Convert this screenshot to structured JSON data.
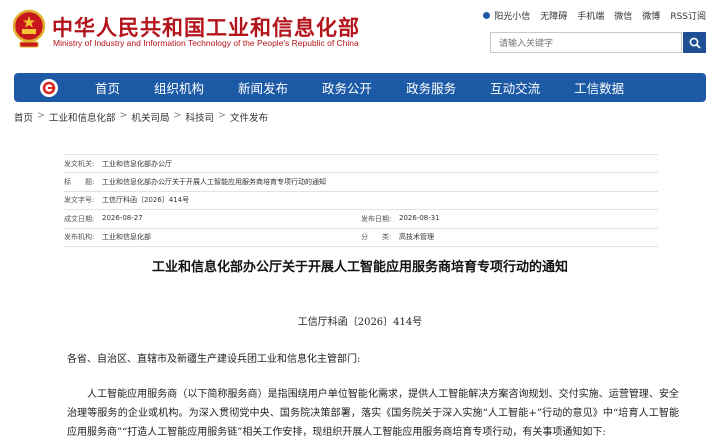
{
  "header": {
    "title": "中华人民共和国工业和信息化部",
    "subtitle": "Ministry of Industry and Information Technology of the People's Republic of China",
    "top_links": [
      "阳光小信",
      "无障碍",
      "手机端",
      "微信",
      "微博",
      "RSS订阅"
    ],
    "search_placeholder": "请输入关键字"
  },
  "nav": {
    "items": [
      "首页",
      "组织机构",
      "新闻发布",
      "政务公开",
      "政务服务",
      "互动交流",
      "工信数据"
    ]
  },
  "breadcrumb": [
    "首页",
    "工业和信息化部",
    "机关司局",
    "科技司",
    "文件发布"
  ],
  "info": {
    "agency_label": "发文机关:",
    "agency": "工业和信息化部办公厅",
    "title_label": "标　　题:",
    "title": "工业和信息化部办公厅关于开展人工智能应用服务商培育专项行动的通知",
    "docno_label": "发文字号:",
    "docno": "工信厅科函〔2026〕414号",
    "written_label": "成文日期:",
    "written": "2026-08-27",
    "published_label": "发布日期:",
    "published": "2026-08-31",
    "issuer_label": "发布机构:",
    "issuer": "工业和信息化部",
    "category_label": "分　　类:",
    "category": "高技术管理"
  },
  "article": {
    "title": "工业和信息化部办公厅关于开展人工智能应用服务商培育专项行动的通知",
    "number": "工信厅科函〔2026〕414号",
    "addressee": "各省、自治区、直辖市及新疆生产建设兵团工业和信息化主管部门:",
    "paragraph": "人工智能应用服务商（以下简称服务商）是指围绕用户单位智能化需求，提供人工智能解决方案咨询规划、交付实施、运营管理、安全治理等服务的企业或机构。为深入贯彻党中央、国务院决策部署，落实《国务院关于深入实施“人工智能+”行动的意见》中“培育人工智能应用服务商”“打造人工智能应用服务链”相关工作安排，现组织开展人工智能应用服务商培育专项行动，有关事项通知如下:"
  },
  "colors": {
    "brand_red": "#b3141b",
    "nav_blue": "#1d5aa6",
    "search_blue": "#1f4f95"
  }
}
